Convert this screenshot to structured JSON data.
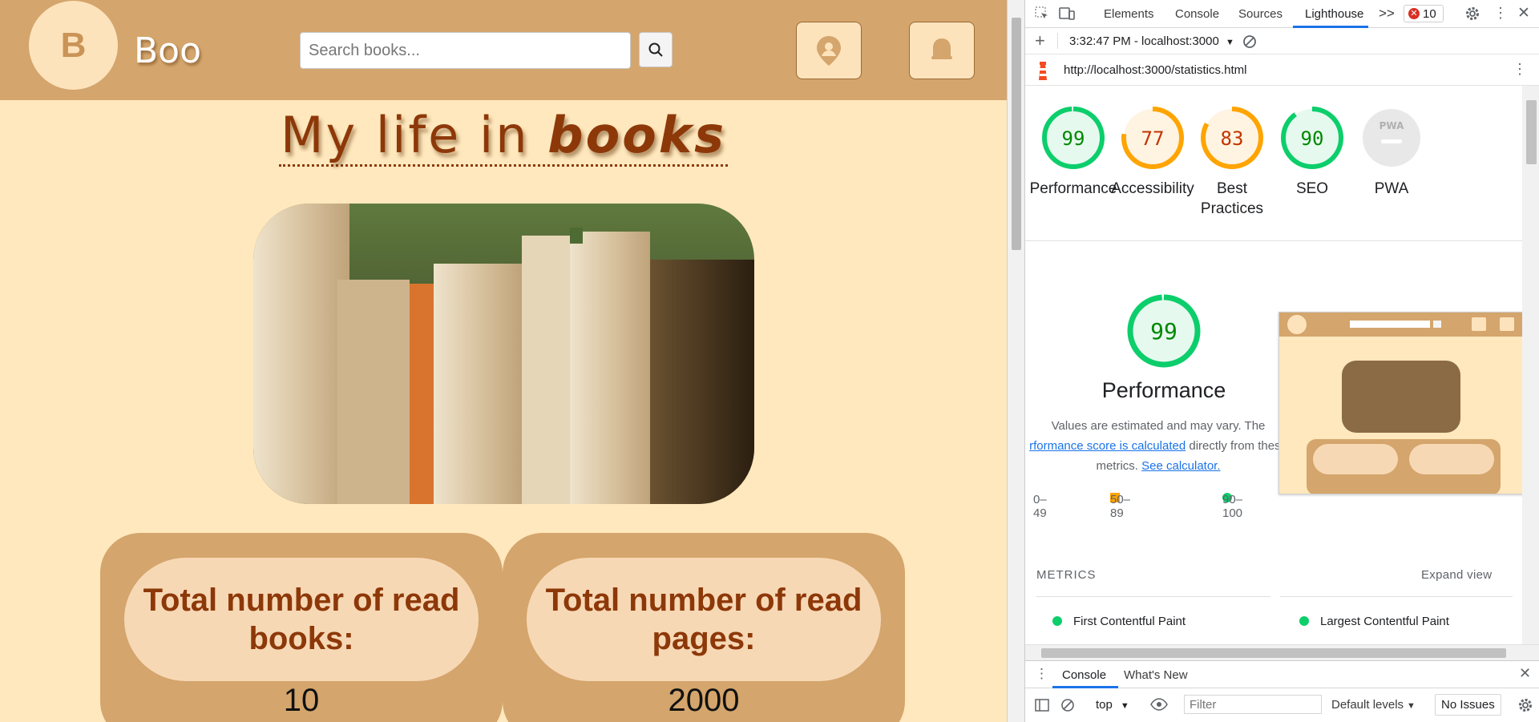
{
  "site": {
    "logo_letter": "B",
    "brand": "Boo",
    "search_placeholder": "Search books...",
    "title_plain": "My life in",
    "title_emph": "books",
    "stats": [
      {
        "label": "Total number of read books:",
        "value": "10"
      },
      {
        "label": "Total number of read pages:",
        "value": "2000"
      }
    ],
    "colors": {
      "header": "#d4a56c",
      "background": "#ffe8bd",
      "accent": "#8d3809",
      "pill": "#f7d8b5"
    }
  },
  "devtools": {
    "tabs": [
      "Elements",
      "Console",
      "Sources",
      "Lighthouse"
    ],
    "active_tab": "Lighthouse",
    "more_tabs": ">>",
    "error_count": "10",
    "report_selector": "3:32:47 PM - localhost:3000",
    "url": "http://localhost:3000/statistics.html",
    "scores": [
      {
        "label": "Performance",
        "score": 99,
        "color": "#0cce6b",
        "text_color": "#008800"
      },
      {
        "label": "Accessibility",
        "score": 77,
        "color": "#ffa400",
        "text_color": "#c33300"
      },
      {
        "label": "Best Practices",
        "score": 83,
        "color": "#ffa400",
        "text_color": "#c33300"
      },
      {
        "label": "SEO",
        "score": 90,
        "color": "#0cce6b",
        "text_color": "#008800"
      },
      {
        "label": "PWA",
        "score": null,
        "color": "#d6d6d6",
        "text_color": "#9e9e9e"
      }
    ],
    "pwa_badge": "PWA",
    "performance": {
      "score": "99",
      "title": "Performance",
      "note_pre": "Values are estimated and may vary. The",
      "note_link": "rformance score is calculated",
      "note_mid": "directly from these",
      "note_post": "metrics.",
      "calc_link": "See calculator."
    },
    "legend": [
      "0–49",
      "50–89",
      "90–100"
    ],
    "metrics_heading": "METRICS",
    "expand_view": "Expand view",
    "metrics": [
      "First Contentful Paint",
      "Largest Contentful Paint"
    ],
    "drawer_tabs": [
      "Console",
      "What's New"
    ],
    "context": "top",
    "filter_placeholder": "Filter",
    "levels": "Default levels",
    "issues": "No Issues"
  }
}
